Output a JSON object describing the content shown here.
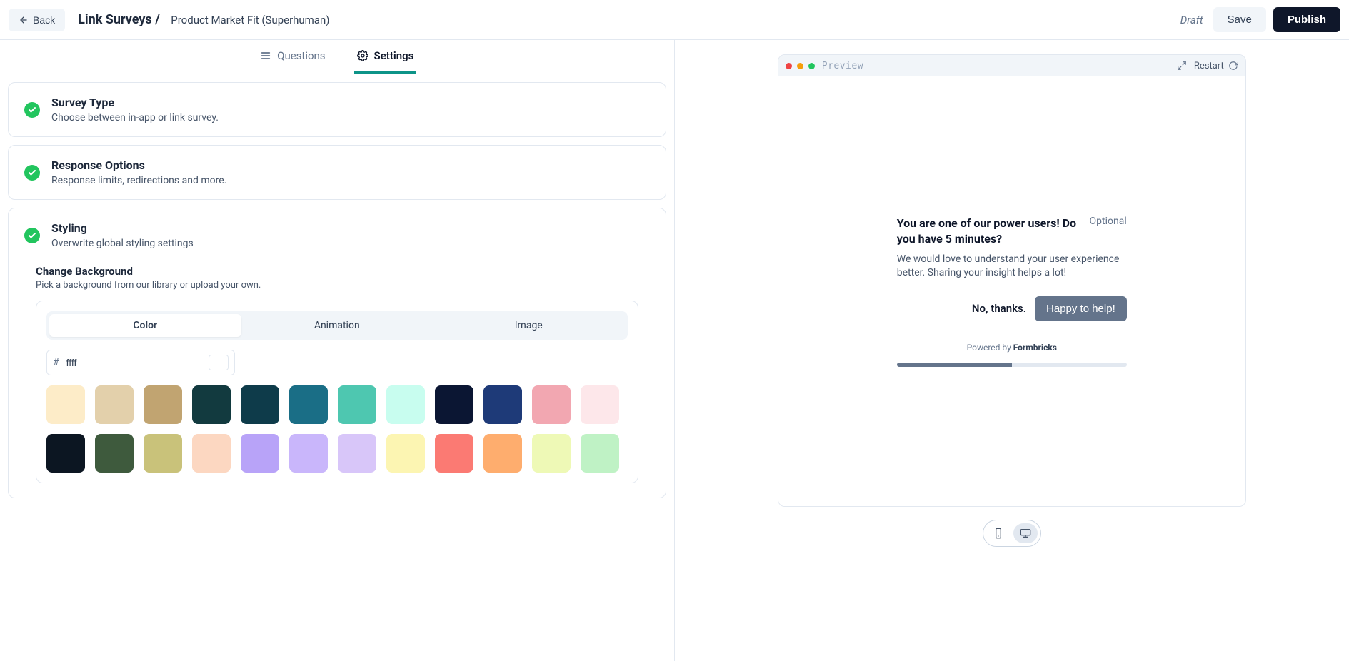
{
  "header": {
    "back_label": "Back",
    "breadcrumb": "Link Surveys /",
    "survey_name": "Product Market Fit (Superhuman)",
    "draft_label": "Draft",
    "save_label": "Save",
    "publish_label": "Publish"
  },
  "tabs": {
    "questions": "Questions",
    "settings": "Settings"
  },
  "cards": {
    "survey_type": {
      "title": "Survey Type",
      "desc": "Choose between in-app or link survey."
    },
    "response_options": {
      "title": "Response Options",
      "desc": "Response limits, redirections and more."
    },
    "styling": {
      "title": "Styling",
      "desc": "Overwrite global styling settings"
    }
  },
  "background": {
    "title": "Change Background",
    "desc": "Pick a background from our library or upload your own.",
    "tabs": {
      "color": "Color",
      "animation": "Animation",
      "image": "Image"
    },
    "hex_value": "ffff",
    "swatches": [
      "#fdecc8",
      "#e3d0ab",
      "#c1a471",
      "#123a3f",
      "#0e3b4a",
      "#1a6e86",
      "#4ec7b0",
      "#c8fdef",
      "#0b1633",
      "#1e3a78",
      "#f2a7b1",
      "#fde7ea",
      "#0c1622",
      "#3e5a3d",
      "#c9c27a",
      "#fcd7c1",
      "#b8a3f8",
      "#c9b6fb",
      "#d8c6f9",
      "#fcf5b2",
      "#fb7a73",
      "#fead6e",
      "#eef9b6",
      "#bff2c5"
    ]
  },
  "preview": {
    "label": "Preview",
    "restart_label": "Restart",
    "question": "You are one of our power users! Do you have 5 minutes?",
    "optional": "Optional",
    "body": "We would love to understand your user experience better. Sharing your insight helps a lot!",
    "skip_label": "No, thanks.",
    "cta_label": "Happy to help!",
    "powered_prefix": "Powered by ",
    "powered_brand": "Formbricks",
    "progress_pct": 50
  }
}
